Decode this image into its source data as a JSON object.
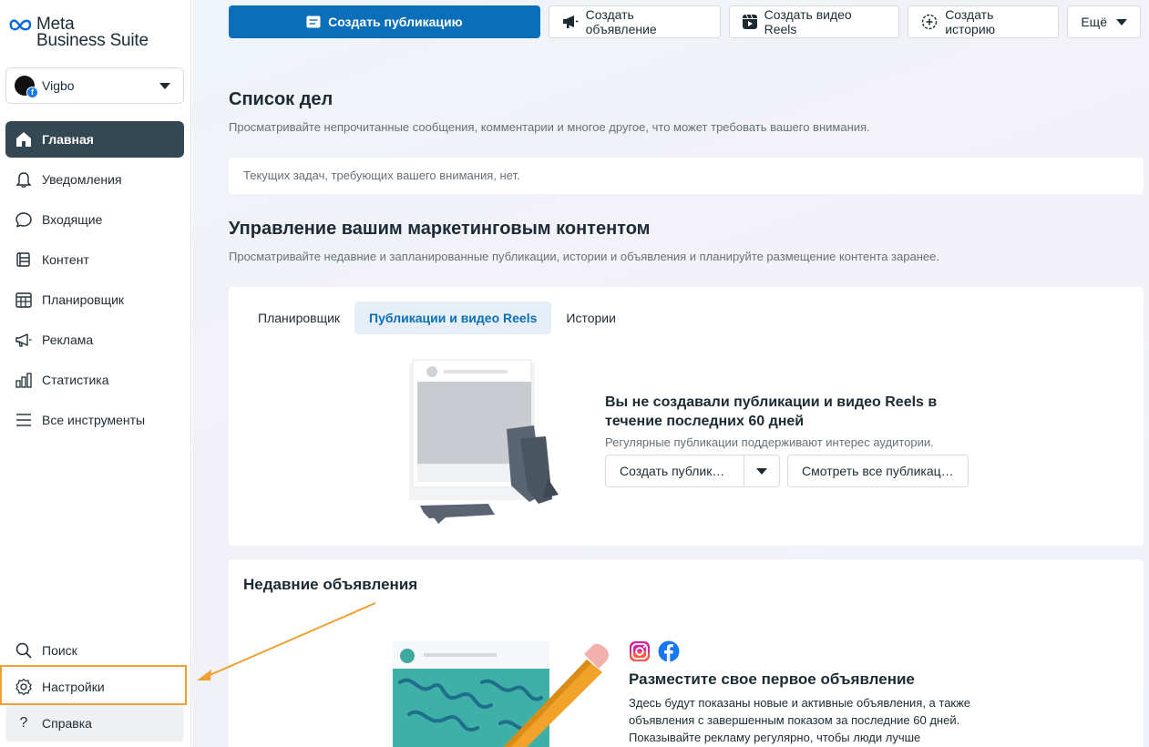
{
  "brand": {
    "line1": "Meta",
    "line2": "Business Suite"
  },
  "account": {
    "name": "Vigbo"
  },
  "nav": {
    "items": [
      {
        "label": "Главная",
        "icon": "home-icon"
      },
      {
        "label": "Уведомления",
        "icon": "bell-icon"
      },
      {
        "label": "Входящие",
        "icon": "chat-bubble-icon"
      },
      {
        "label": "Контент",
        "icon": "content-icon"
      },
      {
        "label": "Планировщик",
        "icon": "calendar-icon"
      },
      {
        "label": "Реклама",
        "icon": "megaphone-icon"
      },
      {
        "label": "Статистика",
        "icon": "bar-chart-icon"
      },
      {
        "label": "Все инструменты",
        "icon": "menu-icon"
      }
    ],
    "bottom": [
      {
        "label": "Поиск",
        "icon": "search-icon"
      },
      {
        "label": "Настройки",
        "icon": "gear-icon"
      },
      {
        "label": "Справка",
        "icon": "help-icon"
      }
    ]
  },
  "actions": {
    "create_post": "Создать публикацию",
    "create_ad": "Создать объявление",
    "create_reels": "Создать видео Reels",
    "create_story": "Создать историю",
    "more": "Ещё"
  },
  "todo": {
    "title": "Список дел",
    "subtitle": "Просматривайте непрочитанные сообщения, комментарии и многое другое, что может требовать вашего внимания.",
    "empty": "Текущих задач, требующих вашего внимания, нет."
  },
  "marketing": {
    "title": "Управление вашим маркетинговым контентом",
    "subtitle": "Просматривайте недавние и запланированные публикации, истории и объявления и планируйте размещение контента заранее.",
    "tabs": [
      "Планировщик",
      "Публикации и видео Reels",
      "Истории"
    ],
    "empty_title": "Вы не создавали публикации и видео Reels в течение последних 60 дней",
    "empty_sub": "Регулярные публикации поддерживают интерес аудитории.",
    "create_btn": "Создать публик…",
    "view_all_btn": "Смотреть все публикац…"
  },
  "ads": {
    "title": "Недавние объявления",
    "heading": "Разместите свое первое объявление",
    "text": "Здесь будут показаны новые и активные объявления, а также объявления с завершенным показом за последние 60 дней. Показывайте рекламу регулярно, чтобы люди лучше"
  },
  "colors": {
    "primary": "#0a6fb8",
    "active_nav": "#344854",
    "highlight": "#f0a030"
  }
}
